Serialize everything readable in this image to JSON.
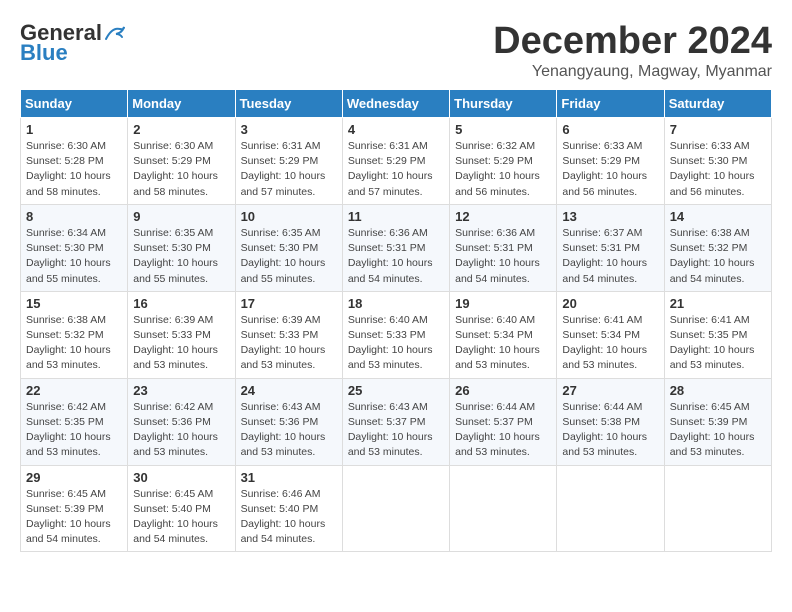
{
  "logo": {
    "line1": "General",
    "line2": "Blue"
  },
  "title": "December 2024",
  "location": "Yenangyaung, Magway, Myanmar",
  "weekdays": [
    "Sunday",
    "Monday",
    "Tuesday",
    "Wednesday",
    "Thursday",
    "Friday",
    "Saturday"
  ],
  "weeks": [
    [
      {
        "day": "1",
        "sunrise": "6:30 AM",
        "sunset": "5:28 PM",
        "daylight": "10 hours and 58 minutes."
      },
      {
        "day": "2",
        "sunrise": "6:30 AM",
        "sunset": "5:29 PM",
        "daylight": "10 hours and 58 minutes."
      },
      {
        "day": "3",
        "sunrise": "6:31 AM",
        "sunset": "5:29 PM",
        "daylight": "10 hours and 57 minutes."
      },
      {
        "day": "4",
        "sunrise": "6:31 AM",
        "sunset": "5:29 PM",
        "daylight": "10 hours and 57 minutes."
      },
      {
        "day": "5",
        "sunrise": "6:32 AM",
        "sunset": "5:29 PM",
        "daylight": "10 hours and 56 minutes."
      },
      {
        "day": "6",
        "sunrise": "6:33 AM",
        "sunset": "5:29 PM",
        "daylight": "10 hours and 56 minutes."
      },
      {
        "day": "7",
        "sunrise": "6:33 AM",
        "sunset": "5:30 PM",
        "daylight": "10 hours and 56 minutes."
      }
    ],
    [
      {
        "day": "8",
        "sunrise": "6:34 AM",
        "sunset": "5:30 PM",
        "daylight": "10 hours and 55 minutes."
      },
      {
        "day": "9",
        "sunrise": "6:35 AM",
        "sunset": "5:30 PM",
        "daylight": "10 hours and 55 minutes."
      },
      {
        "day": "10",
        "sunrise": "6:35 AM",
        "sunset": "5:30 PM",
        "daylight": "10 hours and 55 minutes."
      },
      {
        "day": "11",
        "sunrise": "6:36 AM",
        "sunset": "5:31 PM",
        "daylight": "10 hours and 54 minutes."
      },
      {
        "day": "12",
        "sunrise": "6:36 AM",
        "sunset": "5:31 PM",
        "daylight": "10 hours and 54 minutes."
      },
      {
        "day": "13",
        "sunrise": "6:37 AM",
        "sunset": "5:31 PM",
        "daylight": "10 hours and 54 minutes."
      },
      {
        "day": "14",
        "sunrise": "6:38 AM",
        "sunset": "5:32 PM",
        "daylight": "10 hours and 54 minutes."
      }
    ],
    [
      {
        "day": "15",
        "sunrise": "6:38 AM",
        "sunset": "5:32 PM",
        "daylight": "10 hours and 53 minutes."
      },
      {
        "day": "16",
        "sunrise": "6:39 AM",
        "sunset": "5:33 PM",
        "daylight": "10 hours and 53 minutes."
      },
      {
        "day": "17",
        "sunrise": "6:39 AM",
        "sunset": "5:33 PM",
        "daylight": "10 hours and 53 minutes."
      },
      {
        "day": "18",
        "sunrise": "6:40 AM",
        "sunset": "5:33 PM",
        "daylight": "10 hours and 53 minutes."
      },
      {
        "day": "19",
        "sunrise": "6:40 AM",
        "sunset": "5:34 PM",
        "daylight": "10 hours and 53 minutes."
      },
      {
        "day": "20",
        "sunrise": "6:41 AM",
        "sunset": "5:34 PM",
        "daylight": "10 hours and 53 minutes."
      },
      {
        "day": "21",
        "sunrise": "6:41 AM",
        "sunset": "5:35 PM",
        "daylight": "10 hours and 53 minutes."
      }
    ],
    [
      {
        "day": "22",
        "sunrise": "6:42 AM",
        "sunset": "5:35 PM",
        "daylight": "10 hours and 53 minutes."
      },
      {
        "day": "23",
        "sunrise": "6:42 AM",
        "sunset": "5:36 PM",
        "daylight": "10 hours and 53 minutes."
      },
      {
        "day": "24",
        "sunrise": "6:43 AM",
        "sunset": "5:36 PM",
        "daylight": "10 hours and 53 minutes."
      },
      {
        "day": "25",
        "sunrise": "6:43 AM",
        "sunset": "5:37 PM",
        "daylight": "10 hours and 53 minutes."
      },
      {
        "day": "26",
        "sunrise": "6:44 AM",
        "sunset": "5:37 PM",
        "daylight": "10 hours and 53 minutes."
      },
      {
        "day": "27",
        "sunrise": "6:44 AM",
        "sunset": "5:38 PM",
        "daylight": "10 hours and 53 minutes."
      },
      {
        "day": "28",
        "sunrise": "6:45 AM",
        "sunset": "5:39 PM",
        "daylight": "10 hours and 53 minutes."
      }
    ],
    [
      {
        "day": "29",
        "sunrise": "6:45 AM",
        "sunset": "5:39 PM",
        "daylight": "10 hours and 54 minutes."
      },
      {
        "day": "30",
        "sunrise": "6:45 AM",
        "sunset": "5:40 PM",
        "daylight": "10 hours and 54 minutes."
      },
      {
        "day": "31",
        "sunrise": "6:46 AM",
        "sunset": "5:40 PM",
        "daylight": "10 hours and 54 minutes."
      },
      null,
      null,
      null,
      null
    ]
  ],
  "labels": {
    "sunrise": "Sunrise:",
    "sunset": "Sunset:",
    "daylight": "Daylight:"
  }
}
